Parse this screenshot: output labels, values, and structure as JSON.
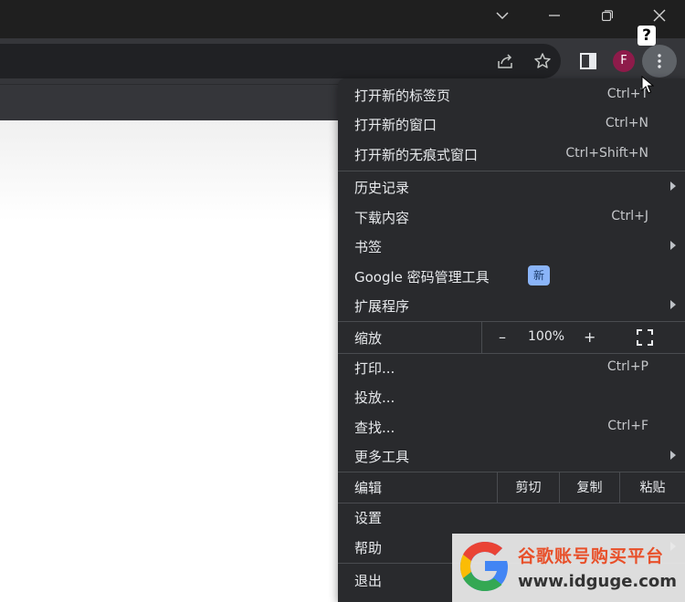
{
  "window": {
    "controls": [
      "chevron-down-icon",
      "minimize-icon",
      "restore-icon",
      "close-icon"
    ]
  },
  "toolbar": {
    "profile_initial": "F",
    "help_badge": "?"
  },
  "menu": {
    "items": [
      {
        "label": "打开新的标签页",
        "shortcut": "Ctrl+T"
      },
      {
        "label": "打开新的窗口",
        "shortcut": "Ctrl+N"
      },
      {
        "label": "打开新的无痕式窗口",
        "shortcut": "Ctrl+Shift+N"
      },
      {
        "label": "历史记录",
        "shortcut": ""
      },
      {
        "label": "下载内容",
        "shortcut": "Ctrl+J"
      },
      {
        "label": "书签",
        "shortcut": ""
      },
      {
        "label": "Google 密码管理工具",
        "badge": "新"
      },
      {
        "label": "扩展程序",
        "shortcut": ""
      },
      {
        "label": "打印...",
        "shortcut": "Ctrl+P"
      },
      {
        "label": "投放...",
        "shortcut": ""
      },
      {
        "label": "查找...",
        "shortcut": "Ctrl+F"
      },
      {
        "label": "更多工具",
        "shortcut": ""
      },
      {
        "label": "设置",
        "shortcut": ""
      },
      {
        "label": "帮助",
        "shortcut": ""
      },
      {
        "label": "退出",
        "shortcut": ""
      }
    ],
    "zoom": {
      "label": "缩放",
      "minus": "–",
      "value": "100%",
      "plus": "+"
    },
    "edit": {
      "label": "编辑",
      "cut": "剪切",
      "copy": "复制",
      "paste": "粘贴"
    }
  },
  "watermark": {
    "title": "谷歌账号购买平台",
    "url": "www.idguge.com"
  },
  "colors": {
    "menu_bg": "#292a2d",
    "toolbar_bg": "#35363a",
    "accent_badge": "#8ab4f8",
    "avatar": "#8e1b4a"
  }
}
